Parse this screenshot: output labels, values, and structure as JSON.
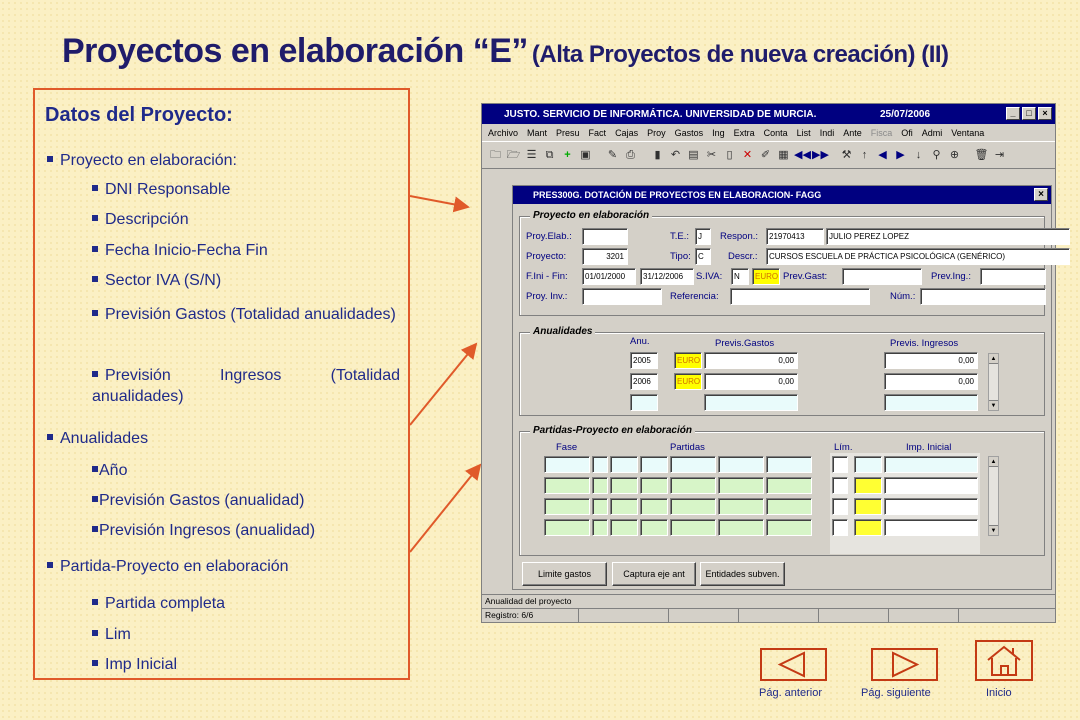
{
  "title": {
    "main": "Proyectos en elaboración “E”",
    "sub": "(Alta Proyectos de nueva creación) (II)"
  },
  "panel": {
    "heading": "Datos del Proyecto:",
    "items": [
      "Proyecto en elaboración:",
      "DNI Responsable",
      "Descripción",
      "Fecha Inicio-Fecha Fin",
      "Sector IVA (S/N)",
      "Previsión Gastos (Totalidad anualidades)",
      "Previsión Ingresos (Totalidad anualidades)",
      "Anualidades",
      "Año",
      "Previsión Gastos (anualidad)",
      "Previsión Ingresos (anualidad)",
      "Partida-Proyecto en elaboración",
      "Partida completa",
      "Lim",
      "Imp Inicial"
    ]
  },
  "app": {
    "title": "JUSTO. SERVICIO DE INFORMÁTICA. UNIVERSIDAD DE MURCIA.",
    "date": "25/07/2006",
    "win_buttons": [
      "_",
      "□",
      "×"
    ],
    "menu": [
      "Archivo",
      "Mant",
      "Presu",
      "Fact",
      "Cajas",
      "Proy",
      "Gastos",
      "Ing",
      "Extra",
      "Conta",
      "List",
      "Indi",
      "Ante",
      "Fisca",
      "Ofi",
      "Admi",
      "Ventana"
    ],
    "menu_disabled": "Fisca",
    "toolbar_icons": [
      "folder-icon",
      "folder-open-icon",
      "list-icon",
      "copy-icon",
      "add-icon",
      "save-icon",
      "edit-icon",
      "print-icon",
      "book-icon",
      "undo-icon",
      "paste-icon",
      "cut-icon",
      "document-icon",
      "delete-icon",
      "edit-pen-icon",
      "table-icon",
      "first-icon",
      "last-icon",
      "tool-icon",
      "up-icon",
      "prev-icon",
      "next-icon",
      "down-icon",
      "search-icon",
      "zoom-icon",
      "trash-icon",
      "exit-icon"
    ],
    "form": {
      "title": "PRES300G. DOTACIÓN DE PROYECTOS EN ELABORACION- FAGG",
      "close": "×",
      "proyecto": {
        "group_label": "Proyecto en elaboración",
        "labels": {
          "proy_elab": "Proy.Elab.:",
          "te": "T.E.:",
          "respon": "Respon.:",
          "proyecto": "Proyecto:",
          "tipo": "Tipo:",
          "descr": "Descr.:",
          "fini": "F.Ini - Fin:",
          "siva": "S.IVA:",
          "prev_gast": "Prev.Gast:",
          "prev_ing": "Prev.Ing.:",
          "proy_inv": "Proy. Inv.:",
          "referencia": "Referencia:",
          "num": "Núm.:"
        },
        "values": {
          "te": "J",
          "respon_dni": "21970413",
          "respon_name": "JULIO PEREZ LOPEZ",
          "proyecto": "3201",
          "tipo": "C",
          "descr": "CURSOS ESCUELA DE PRÁCTICA PSICOLÓGICA (GENÉRICO)",
          "fini": "01/01/2000",
          "ffin": "31/12/2006",
          "siva": "N",
          "moneda": "EURO"
        }
      },
      "anualidades": {
        "group_label": "Anualidades",
        "headers": [
          "Anu.",
          "Previs.Gastos",
          "Previs. Ingresos"
        ],
        "rows": [
          {
            "anu": "2005",
            "moneda": "EURO",
            "gastos": "0,00",
            "ingresos": "0,00"
          },
          {
            "anu": "2006",
            "moneda": "EURO",
            "gastos": "0,00",
            "ingresos": "0,00"
          }
        ]
      },
      "partidas": {
        "group_label": "Partidas-Proyecto en elaboración",
        "headers": [
          "Fase",
          "Partidas",
          "Lím.",
          "Imp. Inicial"
        ]
      },
      "buttons": [
        "Limite gastos",
        "Captura eje ant",
        "Entidades subven."
      ]
    },
    "status_text": "Anualidad del proyecto",
    "status_record": "Registro: 6/6"
  },
  "nav": {
    "prev": "Pág. anterior",
    "next": "Pág. siguiente",
    "home": "Inicio"
  },
  "colors": {
    "title": "#1f1c6b",
    "text": "#1f2a8a",
    "accent": "#e05a2a",
    "background": "#fbf0c4"
  }
}
